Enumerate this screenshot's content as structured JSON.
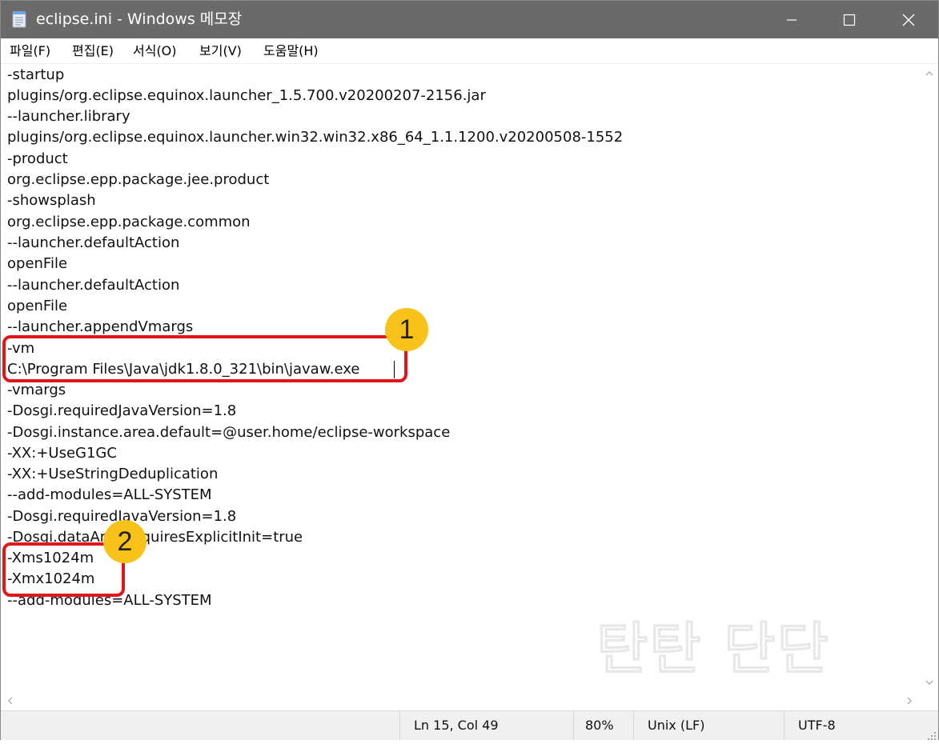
{
  "window": {
    "title": "eclipse.ini - Windows 메모장",
    "icon": "notepad-icon",
    "controls": [
      "minimize-icon",
      "maximize-icon",
      "close-icon"
    ]
  },
  "menu": {
    "file": "파일(F)",
    "edit": "편집(E)",
    "format": "서식(O)",
    "view": "보기(V)",
    "help": "도움말(H)"
  },
  "editor": {
    "lines": [
      "-startup",
      "plugins/org.eclipse.equinox.launcher_1.5.700.v20200207-2156.jar",
      "--launcher.library",
      "plugins/org.eclipse.equinox.launcher.win32.win32.x86_64_1.1.1200.v20200508-1552",
      "-product",
      "org.eclipse.epp.package.jee.product",
      "-showsplash",
      "org.eclipse.epp.package.common",
      "--launcher.defaultAction",
      "openFile",
      "--launcher.defaultAction",
      "openFile",
      "--launcher.appendVmargs",
      "-vm",
      "C:\\Program Files\\Java\\jdk1.8.0_321\\bin\\javaw.exe",
      "-vmargs",
      "-Dosgi.requiredJavaVersion=1.8",
      "-Dosgi.instance.area.default=@user.home/eclipse-workspace",
      "-XX:+UseG1GC",
      "-XX:+UseStringDeduplication",
      "--add-modules=ALL-SYSTEM",
      "-Dosgi.requiredJavaVersion=1.8",
      "-Dosgi.dataAreaRequiresExplicitInit=true",
      "-Xms1024m",
      "-Xmx1024m",
      "--add-modules=ALL-SYSTEM"
    ]
  },
  "annotations": {
    "badge1": "1",
    "badge2": "2",
    "box_color": "#e0161a",
    "badge_color": "#f8c21a"
  },
  "watermark": "탄탄 단단",
  "status": {
    "position": "Ln 15, Col 49",
    "zoom": "80%",
    "line_ending": "Unix (LF)",
    "encoding": "UTF-8"
  }
}
